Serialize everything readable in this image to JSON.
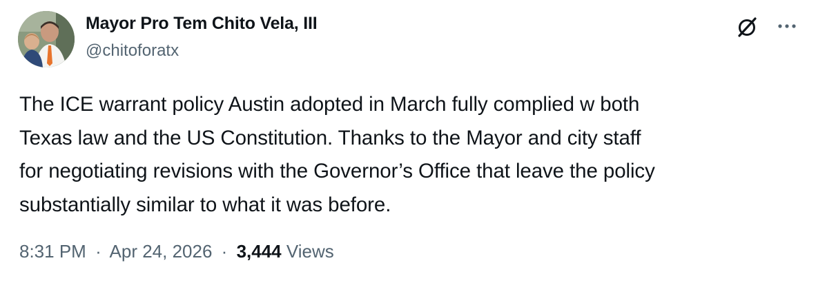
{
  "author": {
    "display_name": "Mayor Pro Tem Chito Vela, III",
    "handle": "@chitoforatx"
  },
  "icons": {
    "avatar": "profile-photo",
    "grok": "grok-icon",
    "more": "more-icon"
  },
  "post": {
    "lines": [
      "The ICE warrant policy Austin adopted in March fully complied w both",
      "Texas law and the US Constitution.  Thanks to the Mayor and city staff",
      "for negotiating revisions with the Governor’s Office that leave the policy",
      "substantially similar to what it was before."
    ]
  },
  "meta": {
    "time": "8:31 PM",
    "separator": "·",
    "date": "Apr 24, 2026",
    "views_count": "3,444",
    "views_label": "Views"
  },
  "colors": {
    "text": "#0f1419",
    "secondary": "#536471"
  }
}
